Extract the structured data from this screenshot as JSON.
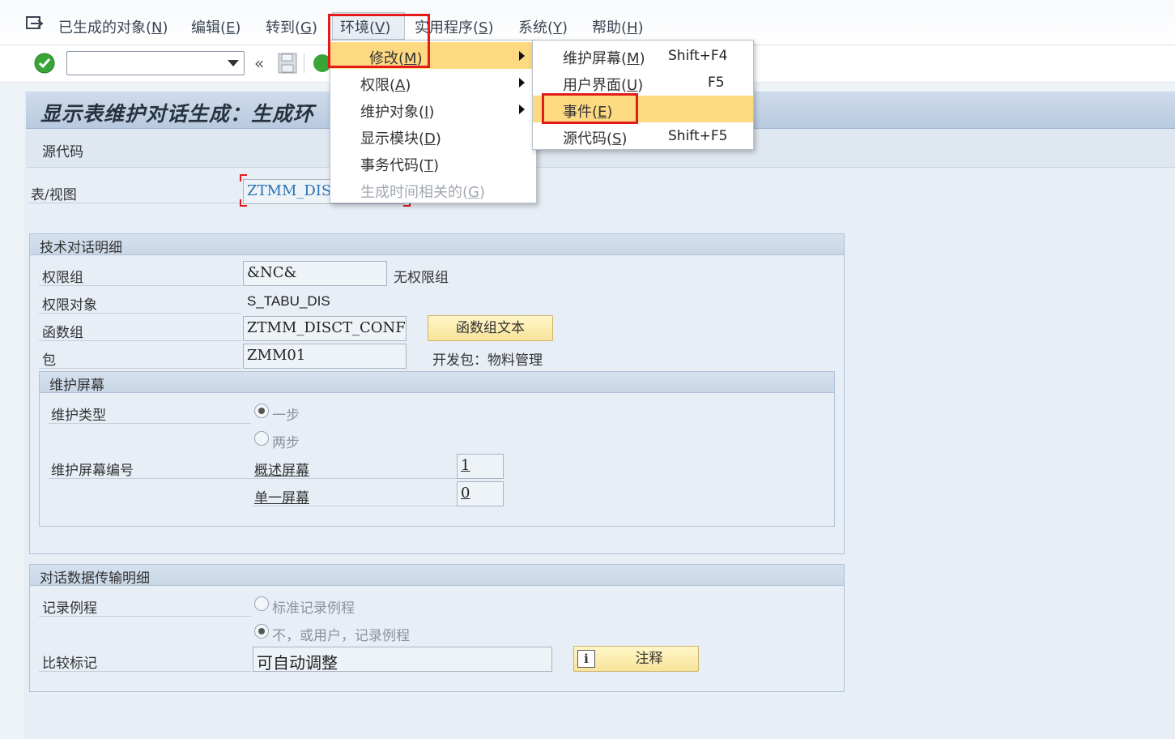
{
  "menubar": {
    "items": [
      {
        "label": "已生成的对象(",
        "key": "N",
        "suffix": ")"
      },
      {
        "label": "编辑(",
        "key": "E",
        "suffix": ")"
      },
      {
        "label": "转到(",
        "key": "G",
        "suffix": ")"
      },
      {
        "label": "环境(",
        "key": "V",
        "suffix": ")"
      },
      {
        "label": "实用程序(",
        "key": "S",
        "suffix": ")"
      },
      {
        "label": "系统(",
        "key": "Y",
        "suffix": ")"
      },
      {
        "label": "帮助(",
        "key": "H",
        "suffix": ")"
      }
    ]
  },
  "toolbar": {
    "command_value": ""
  },
  "page": {
    "title": "显示表维护对话生成：生成环",
    "app_toolbar_button": "源代码"
  },
  "table_view": {
    "label": "表/视图",
    "value": "ZTMM_DISC"
  },
  "tech_group": {
    "title": "技术对话明细",
    "auth_group_label": "权限组",
    "auth_group_value": "&NC&",
    "auth_group_desc": "无权限组",
    "auth_object_label": "权限对象",
    "auth_object_value": "S_TABU_DIS",
    "function_group_label": "函数组",
    "function_group_value": "ZTMM_DISCT_CONFG",
    "function_group_button": "函数组文本",
    "package_label": "包",
    "package_value": "ZMM01",
    "package_desc": "开发包：物料管理"
  },
  "screen_group": {
    "title": "维护屏幕",
    "type_label": "维护类型",
    "option_one": "一步",
    "option_two": "两步",
    "number_label": "维护屏幕编号",
    "overview_label": "概述屏幕",
    "overview_value": "1",
    "single_label": "单一屏幕",
    "single_value": "0"
  },
  "transfer_group": {
    "title": "对话数据传输明细",
    "routine_label": "记录例程",
    "option_standard": "标准记录例程",
    "option_none": "不，或用户，记录例程",
    "compare_label": "比较标记",
    "compare_value": "可自动调整",
    "note_button": "注释"
  },
  "env_menu": {
    "items": [
      {
        "label": "修改(",
        "key": "M",
        "suffix": ")"
      },
      {
        "label": "权限(",
        "key": "A",
        "suffix": ")"
      },
      {
        "label": "维护对象(",
        "key": "I",
        "suffix": ")"
      },
      {
        "label": "显示模块(",
        "key": "D",
        "suffix": ")"
      },
      {
        "label": "事务代码(",
        "key": "T",
        "suffix": ")"
      },
      {
        "label": "生成时间相关的(",
        "key": "G",
        "suffix": ")"
      }
    ]
  },
  "modify_menu": {
    "items": [
      {
        "label": "维护屏幕(",
        "key": "M",
        "suffix": ")",
        "shortcut": "Shift+F4"
      },
      {
        "label": "用户界面(",
        "key": "U",
        "suffix": ")",
        "shortcut": "F5"
      },
      {
        "label": "事件(",
        "key": "E",
        "suffix": ")",
        "shortcut": ""
      },
      {
        "label": "源代码(",
        "key": "S",
        "suffix": ")",
        "shortcut": "Shift+F5"
      }
    ]
  },
  "colors": {
    "highlight": "#fdd982",
    "annotation_red": "#e31b1b",
    "title_bar": "#b8cadf",
    "ok_green": "#3aa537"
  }
}
